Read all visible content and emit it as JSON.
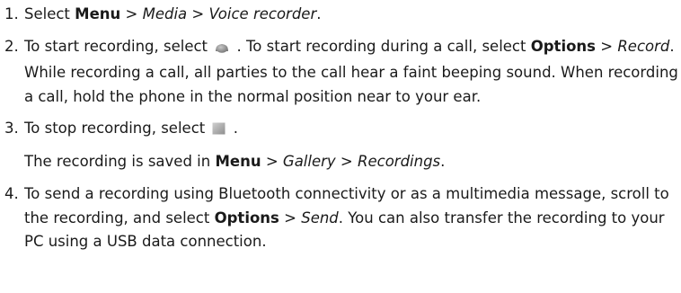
{
  "steps": [
    {
      "num": "1.",
      "t1": "Select ",
      "b1": "Menu",
      "t2": " > ",
      "i1": "Media",
      "t3": " > ",
      "i2": "Voice recorder",
      "t4": "."
    },
    {
      "num": "2.",
      "t1": "To start recording, select ",
      "icon": "record-icon",
      "t2": " . To start recording during a call, select ",
      "b1": "Options",
      "t3": " > ",
      "i1": "Record",
      "t4": ". While recording a call, all parties to the call hear a faint beeping sound. When recording a call, hold the phone in the normal position near to your ear."
    },
    {
      "num": "3.",
      "t1": "To stop recording, select ",
      "icon": "stop-icon",
      "t2": " .",
      "note": {
        "t1": "The recording is saved in ",
        "b1": "Menu",
        "t2": " > ",
        "i1": "Gallery",
        "t3": " > ",
        "i2": "Recordings",
        "t4": "."
      }
    },
    {
      "num": "4.",
      "t1": "To send a recording using Bluetooth connectivity or as a multimedia message, scroll to the recording, and select ",
      "b1": "Options",
      "t2": " > ",
      "i1": "Send",
      "t3": ". You can also transfer the recording to your PC using a USB data connection."
    }
  ],
  "colors": {
    "text": "#1a1a1a",
    "icon_record": "#8c8c8c",
    "icon_stop": "#a6a6a6"
  }
}
